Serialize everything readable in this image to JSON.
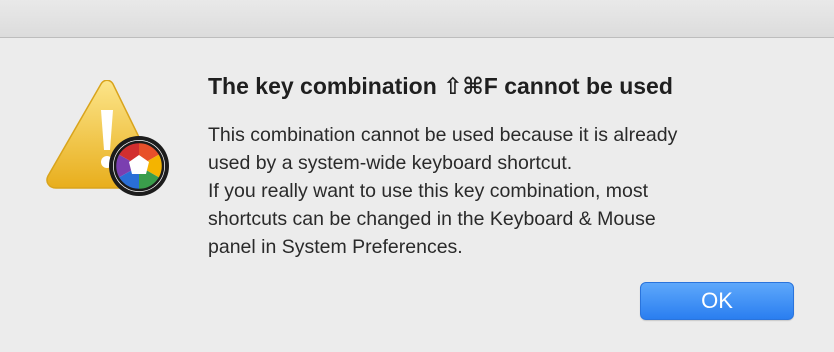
{
  "dialog": {
    "title": "The key combination ⇧⌘F cannot be used",
    "message_lines": [
      "This combination cannot be used because it is already",
      "used by a system-wide keyboard shortcut.",
      "If you really want to use this key combination, most",
      "shortcuts can be changed in the Keyboard & Mouse",
      "panel in System Preferences."
    ],
    "ok_label": "OK"
  },
  "icons": {
    "warning": "warning-triangle-icon",
    "app_badge": "aperture-app-icon"
  },
  "colors": {
    "background": "#ececec",
    "button_accent": "#2a7ef0",
    "warning_yellow": "#f3c233"
  }
}
